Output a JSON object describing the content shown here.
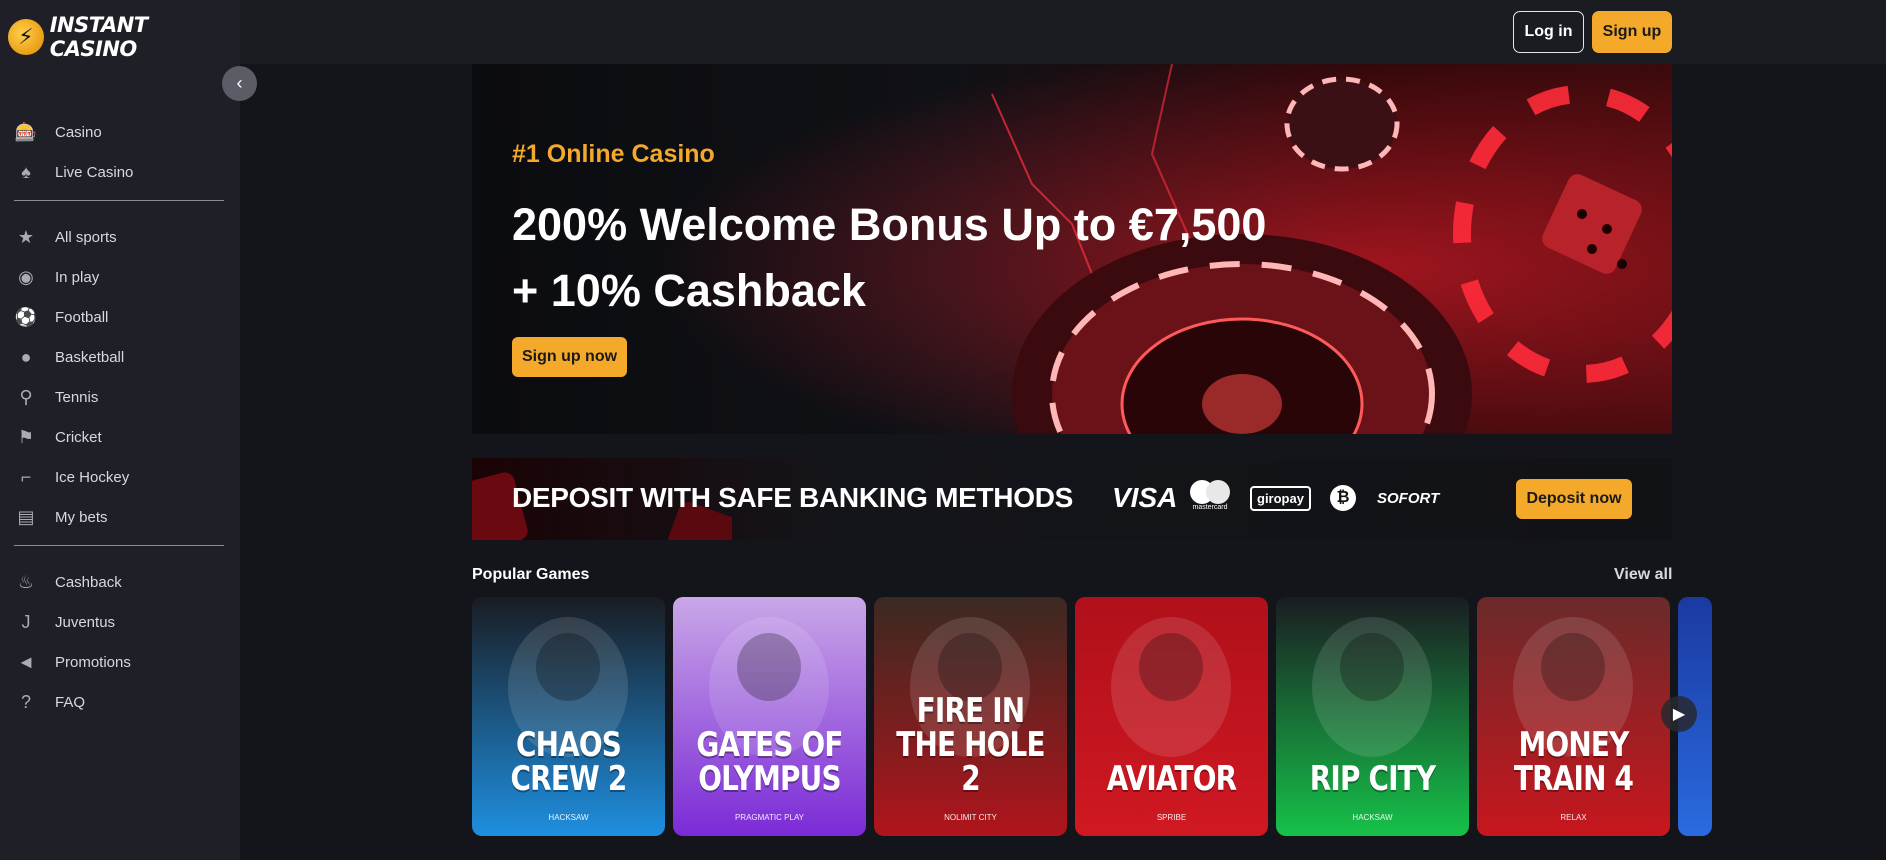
{
  "brand": {
    "logo_text": "INSTANT CASINO",
    "accent": "#f4a92a"
  },
  "sidebar": {
    "groups": [
      {
        "items": [
          {
            "label": "Casino",
            "icon": "slot-machine-icon"
          },
          {
            "label": "Live Casino",
            "icon": "card-icon"
          }
        ]
      },
      {
        "items": [
          {
            "label": "All sports",
            "icon": "star-icon"
          },
          {
            "label": "In play",
            "icon": "broadcast-icon"
          },
          {
            "label": "Football",
            "icon": "football-icon"
          },
          {
            "label": "Basketball",
            "icon": "basketball-icon"
          },
          {
            "label": "Tennis",
            "icon": "tennis-icon"
          },
          {
            "label": "Cricket",
            "icon": "cricket-icon"
          },
          {
            "label": "Ice Hockey",
            "icon": "hockey-stick-icon"
          },
          {
            "label": "My bets",
            "icon": "ticket-icon"
          }
        ]
      },
      {
        "items": [
          {
            "label": "Cashback",
            "icon": "flame-icon"
          },
          {
            "label": "Juventus",
            "icon": "juventus-icon"
          },
          {
            "label": "Promotions",
            "icon": "megaphone-icon"
          },
          {
            "label": "FAQ",
            "icon": "help-icon"
          }
        ]
      }
    ]
  },
  "header": {
    "login_label": "Log in",
    "signup_label": "Sign up"
  },
  "hero": {
    "kicker": "#1 Online Casino",
    "title_line1": "200% Welcome Bonus Up to €7,500",
    "title_line2": "+ 10% Cashback",
    "cta_label": "Sign up now"
  },
  "deposit": {
    "title": "DEPOSIT WITH SAFE BANKING METHODS",
    "methods": {
      "visa": "VISA",
      "mastercard": "mastercard",
      "giropay": "giropay",
      "bitcoin": "₿",
      "sofort": "SOFORT"
    },
    "cta_label": "Deposit now"
  },
  "popular": {
    "title": "Popular Games",
    "view_all_label": "View all",
    "games": [
      {
        "name": "CHAOS CREW 2",
        "provider": "HACKSAW",
        "bg_top": "#1a1c22",
        "bg_bottom": "#1e8fe0"
      },
      {
        "name": "GATES OF OLYMPUS",
        "provider": "PRAGMATIC PLAY",
        "bg_top": "#c9a7e8",
        "bg_bottom": "#7b2ad6"
      },
      {
        "name": "FIRE IN THE HOLE 2",
        "provider": "NOLIMIT CITY",
        "bg_top": "#3a2a22",
        "bg_bottom": "#b1141c"
      },
      {
        "name": "AVIATOR",
        "provider": "SPRIBE",
        "bg_top": "#b0101a",
        "bg_bottom": "#d01822"
      },
      {
        "name": "RIP CITY",
        "provider": "HACKSAW",
        "bg_top": "#1a1c22",
        "bg_bottom": "#16c24a"
      },
      {
        "name": "MONEY TRAIN 4",
        "provider": "RELAX",
        "bg_top": "#6a2a2a",
        "bg_bottom": "#c8161e"
      }
    ]
  }
}
